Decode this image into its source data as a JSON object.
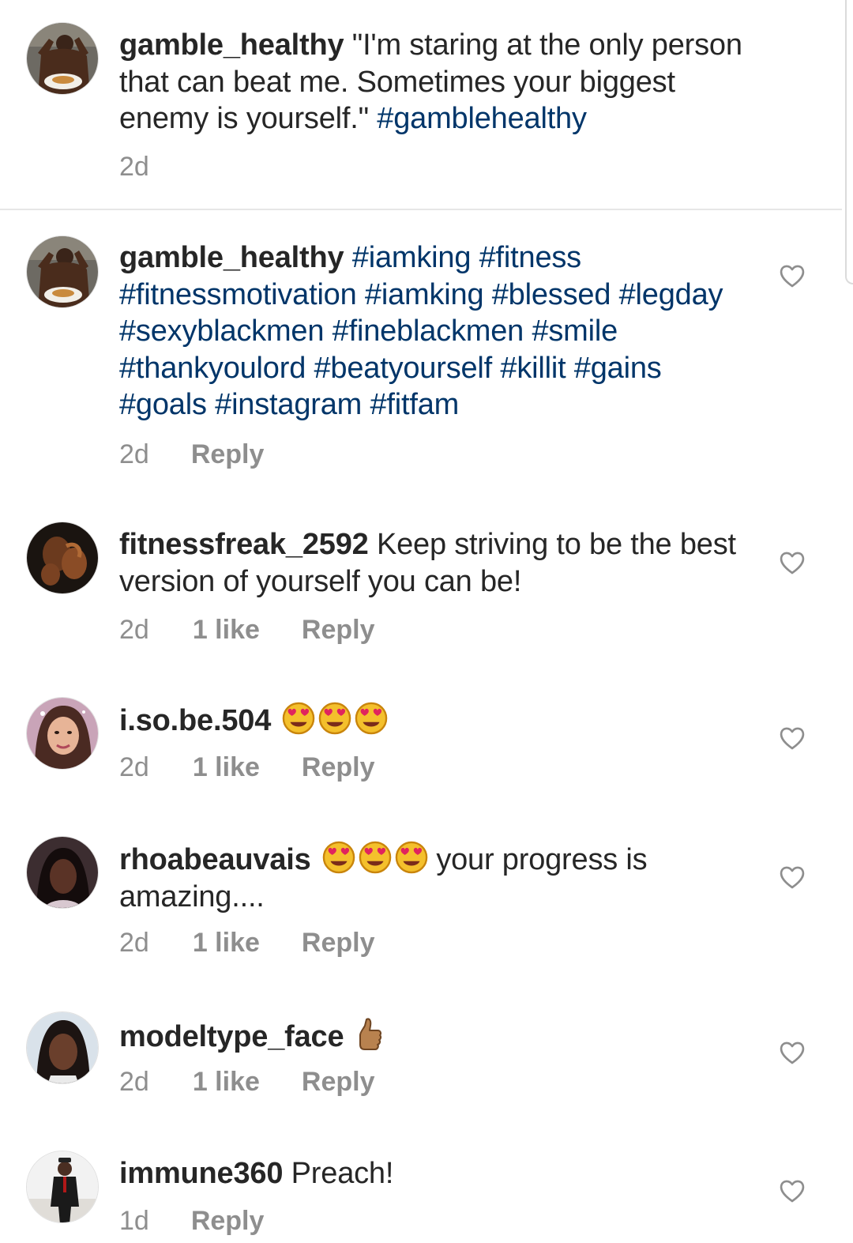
{
  "comments": [
    {
      "username": "gamble_healthy",
      "text": " \"I'm staring at the only person that can beat me. Sometimes your biggest enemy is yourself.\" ",
      "hashtags": "#gamblehealthy",
      "time": "2d",
      "avatar_icon": "profile-photo-muscular-man"
    },
    {
      "username": "gamble_healthy",
      "hashtags": "#iamking #fitness #fitnessmotivation #iamking #blessed #legday #sexyblackmen #fineblackmen #smile #thankyoulord #beatyourself #killit #gains #goals #instagram #fitfam",
      "time": "2d",
      "reply": "Reply",
      "avatar_icon": "profile-photo-muscular-man"
    },
    {
      "username": "fitnessfreak_2592",
      "text": " Keep striving to be the best version of yourself you can be!",
      "time": "2d",
      "likes": "1 like",
      "reply": "Reply",
      "avatar_icon": "profile-photo-bodybuilder"
    },
    {
      "username": "i.so.be.504",
      "emojis": [
        "heart-eyes-emoji",
        "heart-eyes-emoji",
        "heart-eyes-emoji"
      ],
      "time": "2d",
      "likes": "1 like",
      "reply": "Reply",
      "avatar_icon": "profile-photo-woman"
    },
    {
      "username": "rhoabeauvais",
      "emojis": [
        "heart-eyes-emoji",
        "heart-eyes-emoji",
        "heart-eyes-emoji"
      ],
      "text": " your progress is amazing....",
      "time": "2d",
      "likes": "1 like",
      "reply": "Reply",
      "avatar_icon": "profile-photo-woman"
    },
    {
      "username": "modeltype_face",
      "emojis": [
        "thumbs-up-emoji"
      ],
      "time": "2d",
      "likes": "1 like",
      "reply": "Reply",
      "avatar_icon": "profile-photo-woman"
    },
    {
      "username": "immune360",
      "text": " Preach!",
      "time": "1d",
      "reply": "Reply",
      "avatar_icon": "profile-photo-man-suit"
    }
  ],
  "colors": {
    "text": "#262626",
    "hashtag": "#003569",
    "meta": "#8e8e8e",
    "divider": "#e6e6e6"
  },
  "icons": {
    "like": "heart-outline-icon"
  }
}
